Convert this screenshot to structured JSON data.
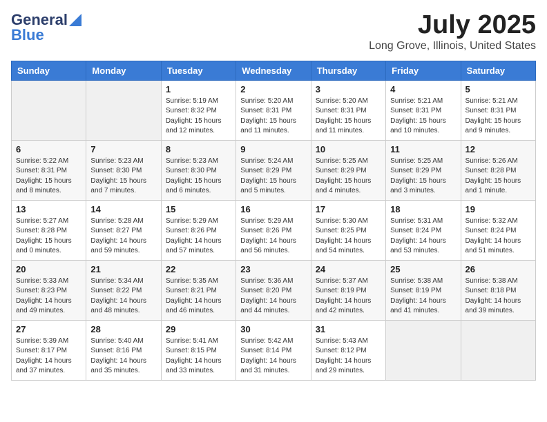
{
  "header": {
    "logo_general": "General",
    "logo_blue": "Blue",
    "month": "July 2025",
    "location": "Long Grove, Illinois, United States"
  },
  "days_of_week": [
    "Sunday",
    "Monday",
    "Tuesday",
    "Wednesday",
    "Thursday",
    "Friday",
    "Saturday"
  ],
  "weeks": [
    [
      {
        "day": "",
        "info": ""
      },
      {
        "day": "",
        "info": ""
      },
      {
        "day": "1",
        "info": "Sunrise: 5:19 AM\nSunset: 8:32 PM\nDaylight: 15 hours\nand 12 minutes."
      },
      {
        "day": "2",
        "info": "Sunrise: 5:20 AM\nSunset: 8:31 PM\nDaylight: 15 hours\nand 11 minutes."
      },
      {
        "day": "3",
        "info": "Sunrise: 5:20 AM\nSunset: 8:31 PM\nDaylight: 15 hours\nand 11 minutes."
      },
      {
        "day": "4",
        "info": "Sunrise: 5:21 AM\nSunset: 8:31 PM\nDaylight: 15 hours\nand 10 minutes."
      },
      {
        "day": "5",
        "info": "Sunrise: 5:21 AM\nSunset: 8:31 PM\nDaylight: 15 hours\nand 9 minutes."
      }
    ],
    [
      {
        "day": "6",
        "info": "Sunrise: 5:22 AM\nSunset: 8:31 PM\nDaylight: 15 hours\nand 8 minutes."
      },
      {
        "day": "7",
        "info": "Sunrise: 5:23 AM\nSunset: 8:30 PM\nDaylight: 15 hours\nand 7 minutes."
      },
      {
        "day": "8",
        "info": "Sunrise: 5:23 AM\nSunset: 8:30 PM\nDaylight: 15 hours\nand 6 minutes."
      },
      {
        "day": "9",
        "info": "Sunrise: 5:24 AM\nSunset: 8:29 PM\nDaylight: 15 hours\nand 5 minutes."
      },
      {
        "day": "10",
        "info": "Sunrise: 5:25 AM\nSunset: 8:29 PM\nDaylight: 15 hours\nand 4 minutes."
      },
      {
        "day": "11",
        "info": "Sunrise: 5:25 AM\nSunset: 8:29 PM\nDaylight: 15 hours\nand 3 minutes."
      },
      {
        "day": "12",
        "info": "Sunrise: 5:26 AM\nSunset: 8:28 PM\nDaylight: 15 hours\nand 1 minute."
      }
    ],
    [
      {
        "day": "13",
        "info": "Sunrise: 5:27 AM\nSunset: 8:28 PM\nDaylight: 15 hours\nand 0 minutes."
      },
      {
        "day": "14",
        "info": "Sunrise: 5:28 AM\nSunset: 8:27 PM\nDaylight: 14 hours\nand 59 minutes."
      },
      {
        "day": "15",
        "info": "Sunrise: 5:29 AM\nSunset: 8:26 PM\nDaylight: 14 hours\nand 57 minutes."
      },
      {
        "day": "16",
        "info": "Sunrise: 5:29 AM\nSunset: 8:26 PM\nDaylight: 14 hours\nand 56 minutes."
      },
      {
        "day": "17",
        "info": "Sunrise: 5:30 AM\nSunset: 8:25 PM\nDaylight: 14 hours\nand 54 minutes."
      },
      {
        "day": "18",
        "info": "Sunrise: 5:31 AM\nSunset: 8:24 PM\nDaylight: 14 hours\nand 53 minutes."
      },
      {
        "day": "19",
        "info": "Sunrise: 5:32 AM\nSunset: 8:24 PM\nDaylight: 14 hours\nand 51 minutes."
      }
    ],
    [
      {
        "day": "20",
        "info": "Sunrise: 5:33 AM\nSunset: 8:23 PM\nDaylight: 14 hours\nand 49 minutes."
      },
      {
        "day": "21",
        "info": "Sunrise: 5:34 AM\nSunset: 8:22 PM\nDaylight: 14 hours\nand 48 minutes."
      },
      {
        "day": "22",
        "info": "Sunrise: 5:35 AM\nSunset: 8:21 PM\nDaylight: 14 hours\nand 46 minutes."
      },
      {
        "day": "23",
        "info": "Sunrise: 5:36 AM\nSunset: 8:20 PM\nDaylight: 14 hours\nand 44 minutes."
      },
      {
        "day": "24",
        "info": "Sunrise: 5:37 AM\nSunset: 8:19 PM\nDaylight: 14 hours\nand 42 minutes."
      },
      {
        "day": "25",
        "info": "Sunrise: 5:38 AM\nSunset: 8:19 PM\nDaylight: 14 hours\nand 41 minutes."
      },
      {
        "day": "26",
        "info": "Sunrise: 5:38 AM\nSunset: 8:18 PM\nDaylight: 14 hours\nand 39 minutes."
      }
    ],
    [
      {
        "day": "27",
        "info": "Sunrise: 5:39 AM\nSunset: 8:17 PM\nDaylight: 14 hours\nand 37 minutes."
      },
      {
        "day": "28",
        "info": "Sunrise: 5:40 AM\nSunset: 8:16 PM\nDaylight: 14 hours\nand 35 minutes."
      },
      {
        "day": "29",
        "info": "Sunrise: 5:41 AM\nSunset: 8:15 PM\nDaylight: 14 hours\nand 33 minutes."
      },
      {
        "day": "30",
        "info": "Sunrise: 5:42 AM\nSunset: 8:14 PM\nDaylight: 14 hours\nand 31 minutes."
      },
      {
        "day": "31",
        "info": "Sunrise: 5:43 AM\nSunset: 8:12 PM\nDaylight: 14 hours\nand 29 minutes."
      },
      {
        "day": "",
        "info": ""
      },
      {
        "day": "",
        "info": ""
      }
    ]
  ]
}
